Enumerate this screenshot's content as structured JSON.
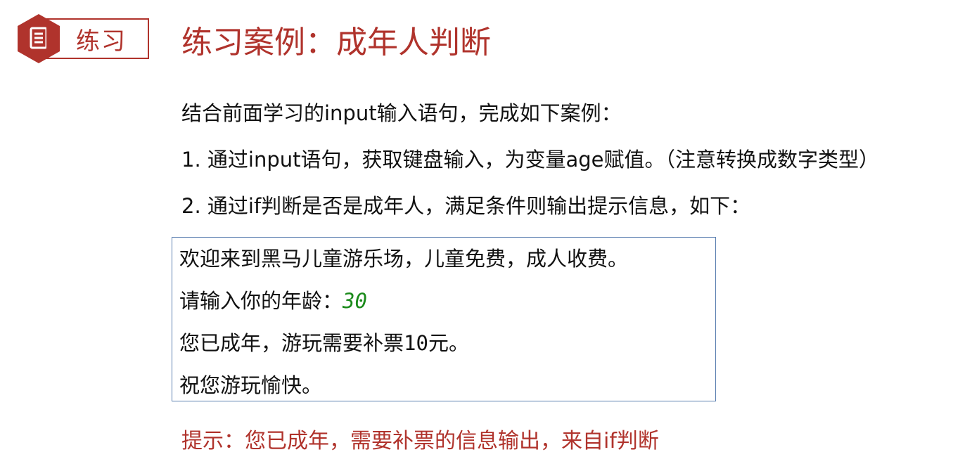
{
  "badge": {
    "label": "练习",
    "icon": "document-icon",
    "color": "#b0332c"
  },
  "title": "练习案例：成年人判断",
  "instructions": {
    "intro": "结合前面学习的input输入语句，完成如下案例：",
    "step1": "1. 通过input语句，获取键盘输入，为变量age赋值。（注意转换成数字类型）",
    "step2": "2. 通过if判断是否是成年人，满足条件则输出提示信息，如下："
  },
  "console": {
    "line1": "欢迎来到黑马儿童游乐场，儿童免费，成人收费。",
    "line2_prompt": "请输入你的年龄：",
    "line2_input": "30",
    "line3_prefix": "您已成年，游玩需要补票",
    "line3_number": "10",
    "line3_suffix": "元。",
    "line4": "祝您游玩愉快。",
    "input_color": "#1a8a1a",
    "border_color": "#5b7fb0"
  },
  "hint": "提示：您已成年，需要补票的信息输出，来自if判断"
}
